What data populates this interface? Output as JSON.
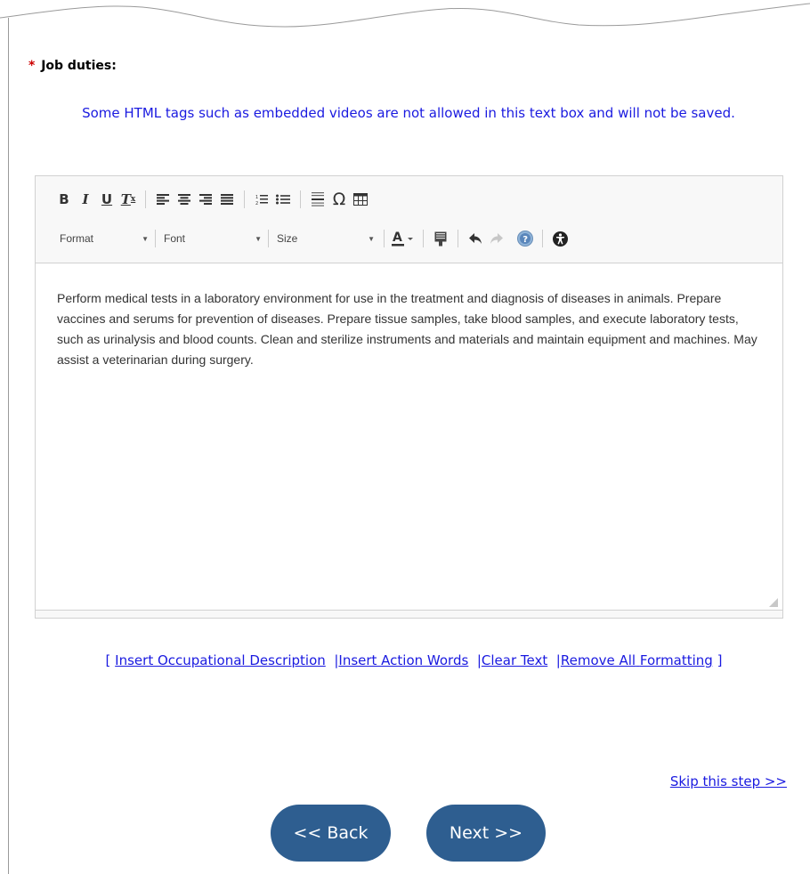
{
  "field": {
    "required_marker": "*",
    "label": "Job duties:"
  },
  "notice": "Some HTML tags such as embedded videos are not allowed in this text box and will not be saved.",
  "toolbar": {
    "row1": [
      {
        "name": "bold-button",
        "glyph": "B"
      },
      {
        "name": "italic-button",
        "glyph": "I"
      },
      {
        "name": "underline-button",
        "glyph": "U"
      },
      {
        "name": "remove-format-button",
        "glyph": "Tx"
      },
      {
        "name": "align-left-button",
        "glyph": "align-left"
      },
      {
        "name": "align-center-button",
        "glyph": "align-center"
      },
      {
        "name": "align-right-button",
        "glyph": "align-right"
      },
      {
        "name": "justify-button",
        "glyph": "justify"
      },
      {
        "name": "numbered-list-button",
        "glyph": "numbered-list"
      },
      {
        "name": "bulleted-list-button",
        "glyph": "bulleted-list"
      },
      {
        "name": "horizontal-line-button",
        "glyph": "horizontal-line"
      },
      {
        "name": "special-char-button",
        "glyph": "Ω"
      },
      {
        "name": "table-button",
        "glyph": "table"
      }
    ],
    "combos": {
      "format": "Format",
      "font": "Font",
      "size": "Size"
    }
  },
  "editor_text": "Perform medical tests in a laboratory environment for use in the treatment and diagnosis of diseases in animals. Prepare vaccines and serums for prevention of diseases. Prepare tissue samples, take blood samples, and execute laboratory tests, such as urinalysis and blood counts. Clean and sterilize instruments and materials and maintain equipment and machines. May assist a veterinarian during surgery.",
  "links": {
    "open_bracket": "[",
    "insert_description": "Insert Occupational Description",
    "insert_action_words": "Insert Action Words",
    "clear_text": "Clear Text",
    "remove_formatting_1": "Remove All",
    "remove_formatting_2": "Formatting",
    "close_bracket": "]",
    "separator": "|"
  },
  "skip_link": "Skip this step >>",
  "buttons": {
    "back": "<< Back",
    "next": "Next >>"
  },
  "colors": {
    "link": "#1a1ae0",
    "required": "#cc0000",
    "button_bg": "#2e5e90"
  }
}
